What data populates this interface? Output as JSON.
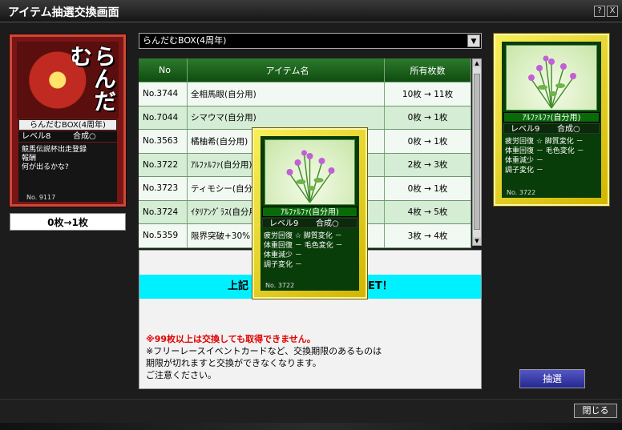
{
  "window": {
    "title": "アイテム抽選交換画面",
    "help_label": "?",
    "close_label": "X"
  },
  "left_card": {
    "art_text": "らんだむ",
    "name": "らんだむBOX(4周年)",
    "level": "レベル8",
    "synthesis": "合成○",
    "description": "競馬伝説杯出走登録\n報酬\n何が出るかな?",
    "number": "No. 9117"
  },
  "count_display": "0枚→1枚",
  "dropdown": {
    "selected": "らんだむBOX(4周年)"
  },
  "table": {
    "headers": [
      "No",
      "アイテム名",
      "所有枚数"
    ],
    "rows": [
      {
        "no": "No.3744",
        "name": "全相馬眼(自分用)",
        "count": "10枚 → 11枚"
      },
      {
        "no": "No.7044",
        "name": "シマウマ(自分用)",
        "count": "0枚 → 1枚"
      },
      {
        "no": "No.3563",
        "name": "橘柚希(自分用)",
        "count": "0枚 → 1枚"
      },
      {
        "no": "No.3722",
        "name": "ｱﾙﾌｧﾙﾌｧ(自分用)",
        "count": "2枚 → 3枚"
      },
      {
        "no": "No.3723",
        "name": "ティモシー(自分用)",
        "count": "0枚 → 1枚"
      },
      {
        "no": "No.3724",
        "name": "ｲﾀﾘｱﾝｸﾞﾗｽ(自分用)",
        "count": "4枚 → 5枚"
      },
      {
        "no": "No.5359",
        "name": "限界突破+30%",
        "count": "3枚 → 4枚"
      }
    ]
  },
  "result": {
    "banner_left": "上記",
    "banner_right": "ET！",
    "warning": "※99枚以上は交換しても取得できません。",
    "note_lines": [
      "※フリーレースイベントカードなど、交換期限のあるものは",
      "期限が切れますと交換ができなくなります。",
      "ご注意ください。"
    ]
  },
  "item_card": {
    "name": "ｱﾙﾌｧﾙﾌｧ(自分用)",
    "level": "レベル9",
    "synthesis": "合成○",
    "effects": [
      "疲労回復 ☆ 脚質変化 －",
      "体重回復 － 毛色変化 －",
      "体重減少 －",
      "調子変化 －"
    ],
    "number": "No. 3722"
  },
  "buttons": {
    "draw": "抽選",
    "close": "閉じる"
  }
}
